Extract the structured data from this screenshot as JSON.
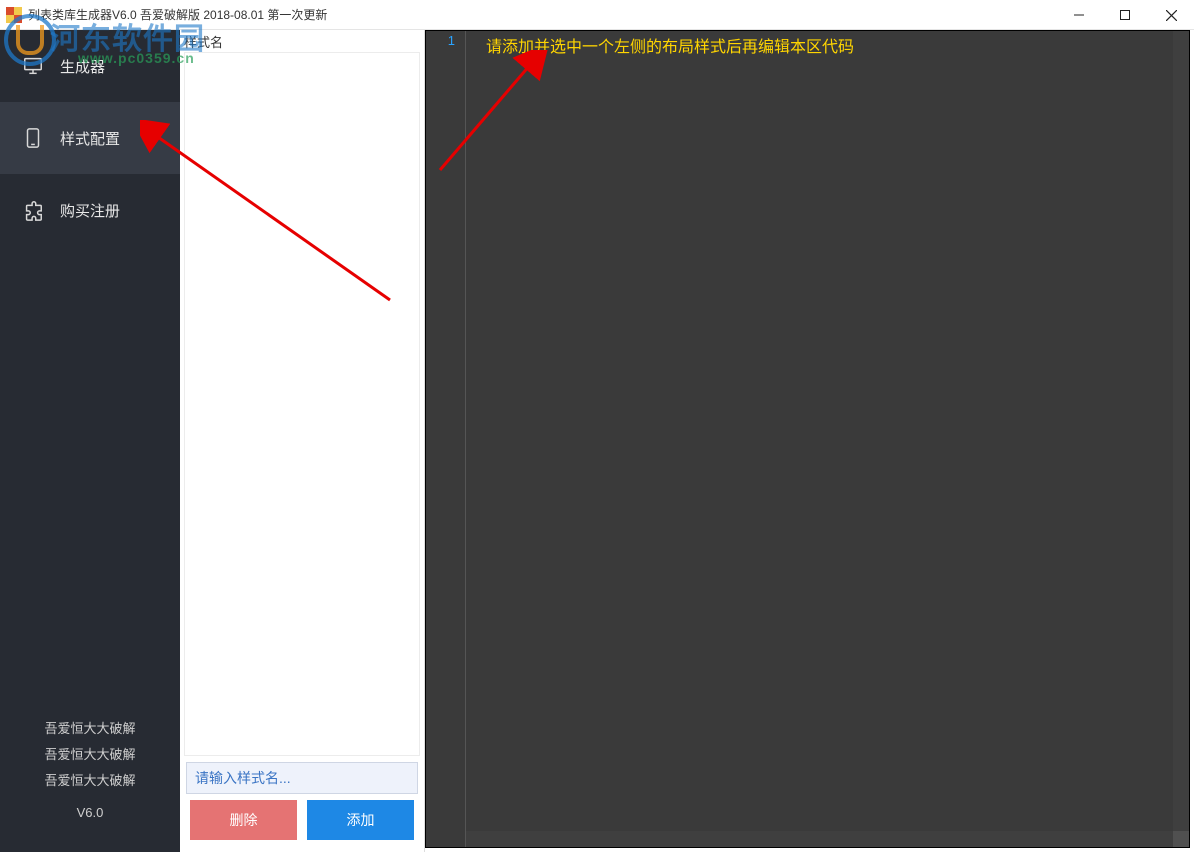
{
  "window": {
    "title": "列表类库生成器V6.0 吾爱破解版 2018-08.01 第一次更新"
  },
  "sidebar": {
    "items": [
      {
        "label": "生成器",
        "icon": "monitor"
      },
      {
        "label": "样式配置",
        "icon": "phone"
      },
      {
        "label": "购买注册",
        "icon": "puzzle"
      }
    ],
    "selected_index": 1,
    "footer_lines": [
      "吾爱恒大大破解",
      "吾爱恒大大破解",
      "吾爱恒大大破解"
    ],
    "version": "V6.0"
  },
  "style_column": {
    "header": "样式名",
    "new_name_placeholder": "请输入样式名...",
    "delete_label": "删除",
    "add_label": "添加"
  },
  "editor": {
    "line_number": "1",
    "placeholder": "请添加并选中一个左侧的布局样式后再编辑本区代码"
  },
  "watermark": {
    "name": "河东软件园",
    "url": "www.pc0359.cn"
  },
  "colors": {
    "sidebar_bg": "#272b33",
    "sidebar_sel": "#363b45",
    "editor_bg": "#3a3a3a",
    "add": "#1e88e5",
    "del": "#e57373",
    "hint": "#ffd500",
    "linenum": "#2aa3ff"
  }
}
